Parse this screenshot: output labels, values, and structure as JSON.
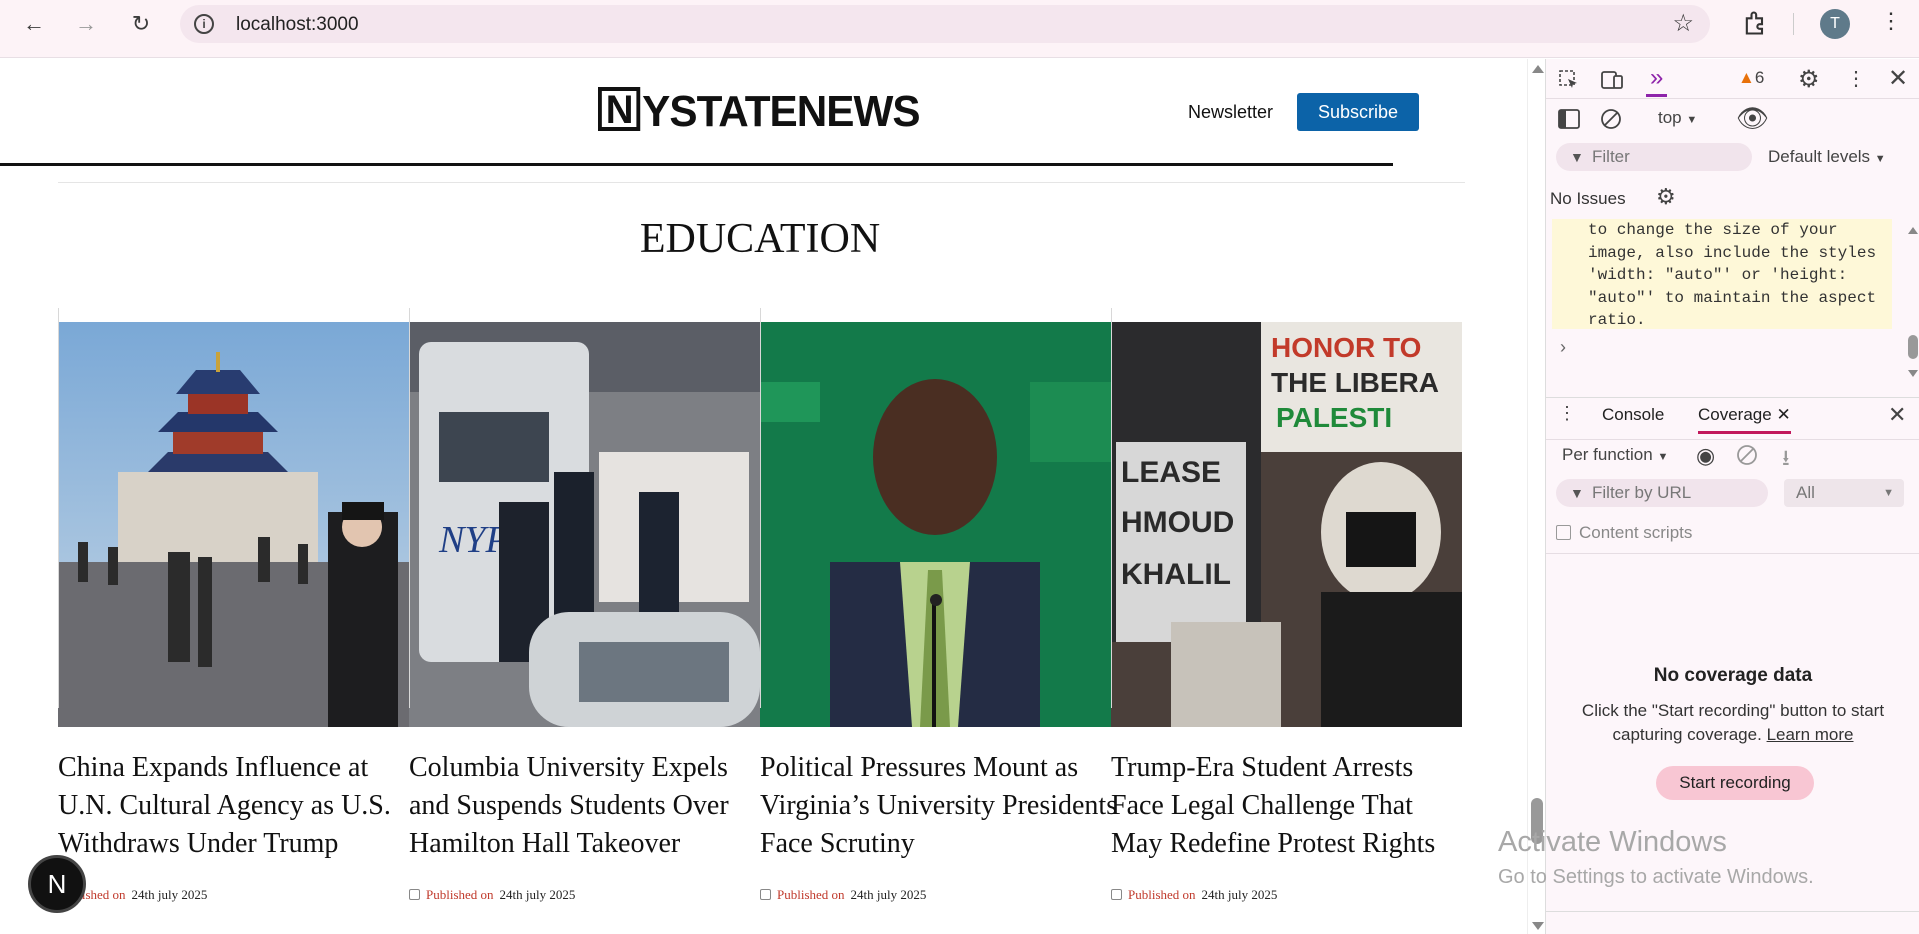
{
  "browser": {
    "url": "localhost:3000",
    "profile_initial": "T"
  },
  "site": {
    "logo_text": "YSTATENEWS",
    "logo_letter": "N",
    "newsletter": "Newsletter",
    "subscribe": "Subscribe",
    "section_title": "EDUCATION",
    "fab_letter": "N"
  },
  "articles": [
    {
      "title": "China Expands Influence at U.N. Cultural Agency as U.S. Withdraws Under Trump",
      "published_label": "Published on",
      "date": "24th july 2025",
      "image": "temple-of-heaven-photo"
    },
    {
      "title": "Columbia University Expels and Suspends Students Over Hamilton Hall Takeover",
      "published_label": "Published on",
      "date": "24th july 2025",
      "image": "nypd-bus-photo"
    },
    {
      "title": "Political Pressures Mount as Virginia’s University Presidents Face Scrutiny",
      "published_label": "Published on",
      "date": "24th july 2025",
      "image": "speaker-podium-photo"
    },
    {
      "title": "Trump-Era Student Arrests Face Legal Challenge That May Redefine Protest Rights",
      "published_label": "Published on",
      "date": "24th july 2025",
      "image": "protest-signs-photo"
    }
  ],
  "devtools": {
    "warnings_count": "6",
    "context": "top",
    "filter_placeholder": "Filter",
    "levels": "Default levels",
    "issues": "No Issues",
    "console_message": "to change the size of your image, also include the styles 'width: \"auto\"' or 'height: \"auto\"' to maintain the aspect ratio.",
    "tab_console": "Console",
    "tab_coverage": "Coverage",
    "per_function": "Per function",
    "url_filter_placeholder": "Filter by URL",
    "type_filter": "All",
    "content_scripts": "Content scripts",
    "no_coverage_title": "No coverage data",
    "no_coverage_text": "Click the \"Start recording\" button to start capturing coverage.",
    "learn_more": "Learn more",
    "start_recording": "Start recording"
  },
  "os_watermark": {
    "line1": "Activate Windows",
    "line2": "Go to Settings to activate Windows."
  }
}
